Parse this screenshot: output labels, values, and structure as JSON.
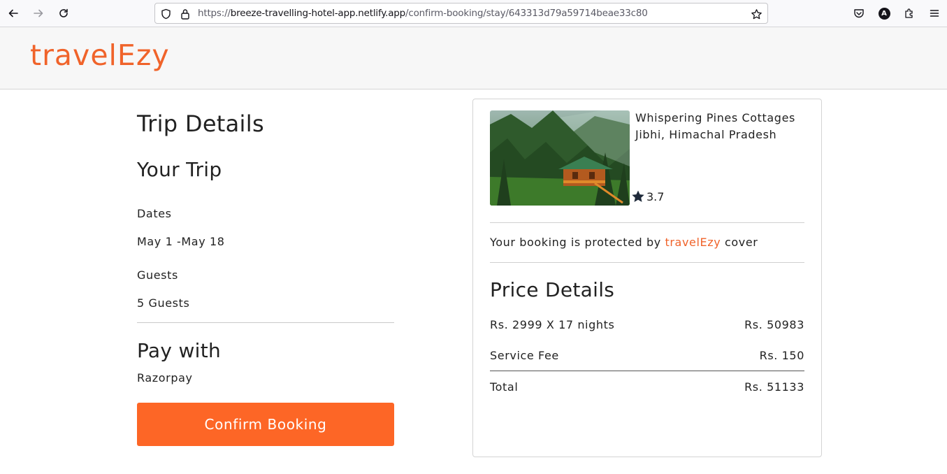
{
  "browser": {
    "url_prefix": "https://",
    "url_host": "breeze-travelling-hotel-app.netlify.app",
    "url_path": "/confirm-booking/stay/643313d79a59714beae33c80",
    "account_initial": "A"
  },
  "brand": {
    "logo": "travelEzy",
    "accent_color": "#f0632a"
  },
  "trip": {
    "title": "Trip Details",
    "your_trip": "Your Trip",
    "dates_label": "Dates",
    "dates_value": "May 1 -May 18",
    "guests_label": "Guests",
    "guests_value": "5 Guests",
    "pay_with_label": "Pay with",
    "pay_with_value": "Razorpay",
    "confirm_button": "Confirm Booking"
  },
  "hotel": {
    "name": "Whispering Pines Cottages",
    "location": "Jibhi, Himachal Pradesh",
    "rating": "3.7",
    "protect_prefix": "Your booking is protected by ",
    "protect_brand": "travelEzy",
    "protect_suffix": " cover"
  },
  "price": {
    "title": "Price Details",
    "nights_label": "Rs. 2999 X 17 nights",
    "nights_value": "Rs. 50983",
    "fee_label": "Service Fee",
    "fee_value": "Rs. 150",
    "total_label": "Total",
    "total_value": "Rs. 51133"
  }
}
